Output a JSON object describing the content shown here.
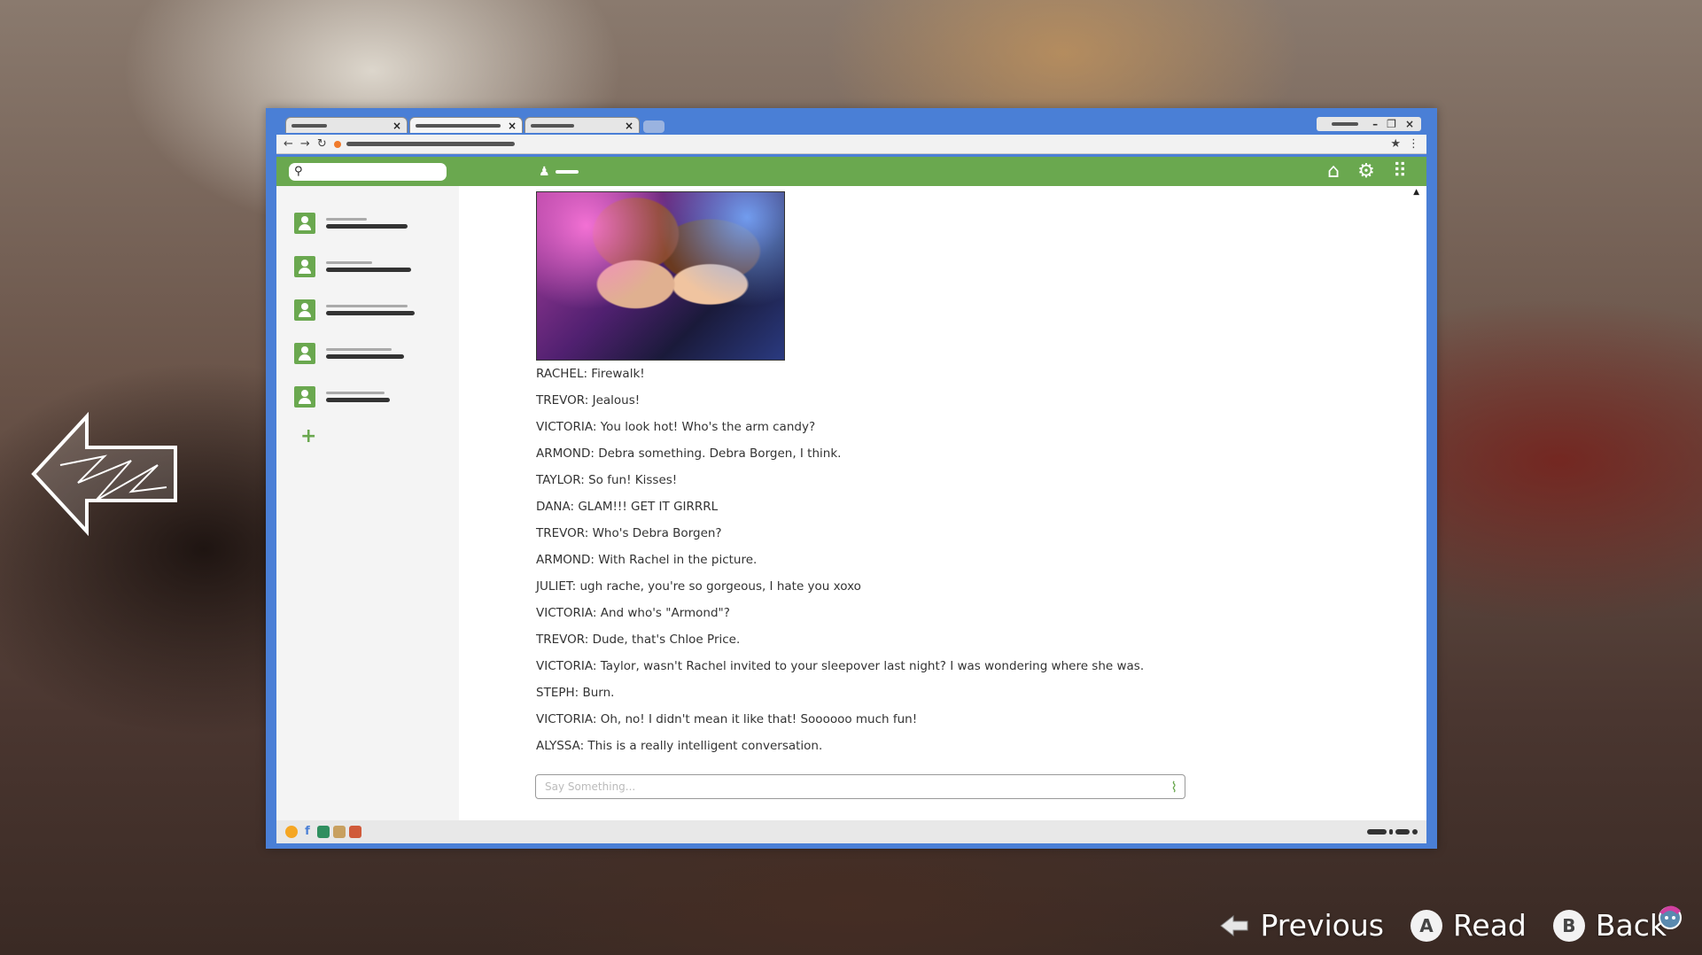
{
  "messages": [
    "RACHEL: Firewalk!",
    "TREVOR: Jealous!",
    "VICTORIA: You look hot! Who's the arm candy?",
    "ARMOND: Debra something. Debra Borgen, I think.",
    "TAYLOR: So fun! Kisses!",
    "DANA: GLAM!!! GET IT GIRRRL",
    "TREVOR: Who's Debra Borgen?",
    "ARMOND: With Rachel in the picture.",
    "JULIET: ugh rache, you're so gorgeous, I hate you xoxo",
    "VICTORIA: And who's \"Armond\"?",
    "TREVOR: Dude, that's Chloe Price.",
    "VICTORIA: Taylor, wasn't Rachel invited to your sleepover last night? I was wondering where she was.",
    "STEPH: Burn.",
    "VICTORIA: Oh, no! I didn't mean it like that! Soooooo much fun!",
    "ALYSSA: This is a really intelligent conversation."
  ],
  "compose": {
    "placeholder": "Say Something..."
  },
  "prompts": {
    "previous": "Previous",
    "read": "Read",
    "back": "Back",
    "a_glyph": "A",
    "b_glyph": "B"
  },
  "taskbar_icons": [
    "orange-dot",
    "f-icon",
    "green-app",
    "book-app",
    "red-app"
  ],
  "colors": {
    "window_border": "#4a7fd6",
    "accent_green": "#6aa84f"
  }
}
